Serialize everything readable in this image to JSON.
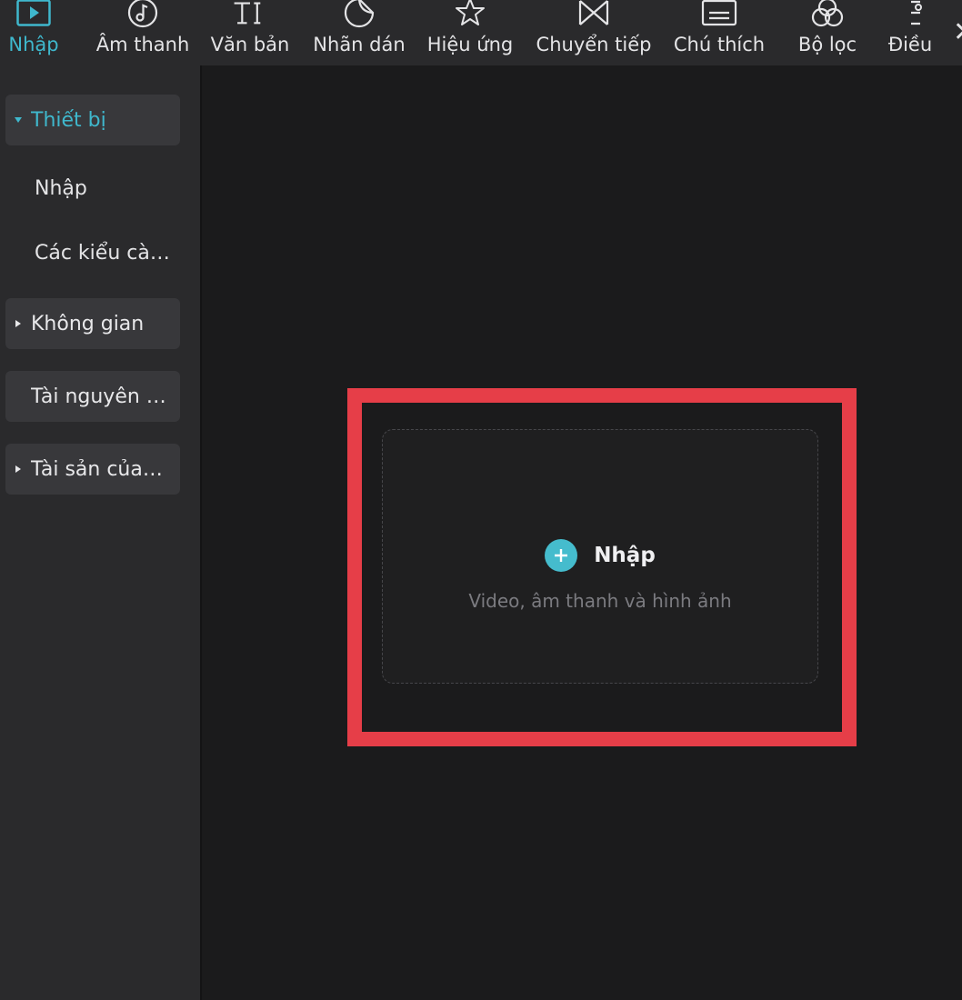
{
  "toolbar": {
    "tabs": [
      {
        "label": "Nhập",
        "icon": "media-import-icon",
        "active": true
      },
      {
        "label": "Âm thanh",
        "icon": "music-note-icon"
      },
      {
        "label": "Văn bản",
        "icon": "text-icon"
      },
      {
        "label": "Nhãn dán",
        "icon": "sticker-icon"
      },
      {
        "label": "Hiệu ứng",
        "icon": "effects-star-icon"
      },
      {
        "label": "Chuyển tiếp",
        "icon": "transition-icon"
      },
      {
        "label": "Chú thích",
        "icon": "caption-icon"
      },
      {
        "label": "Bộ lọc",
        "icon": "filter-icon"
      },
      {
        "label": "Điều",
        "icon": "adjust-icon"
      }
    ],
    "accent": "#3fb8cd"
  },
  "sidebar": {
    "groups": [
      {
        "label": "Thiết bị",
        "expanded": true
      },
      {
        "label": "Không gian"
      },
      {
        "label": "Tài nguyên …"
      },
      {
        "label": "Tài sản của…"
      }
    ],
    "items": [
      {
        "label": "Nhập"
      },
      {
        "label": "Các kiểu cà…"
      }
    ]
  },
  "main": {
    "import_label": "Nhập",
    "import_hint": "Video, âm thanh và hình ảnh",
    "highlight_color": "#e63e48"
  }
}
